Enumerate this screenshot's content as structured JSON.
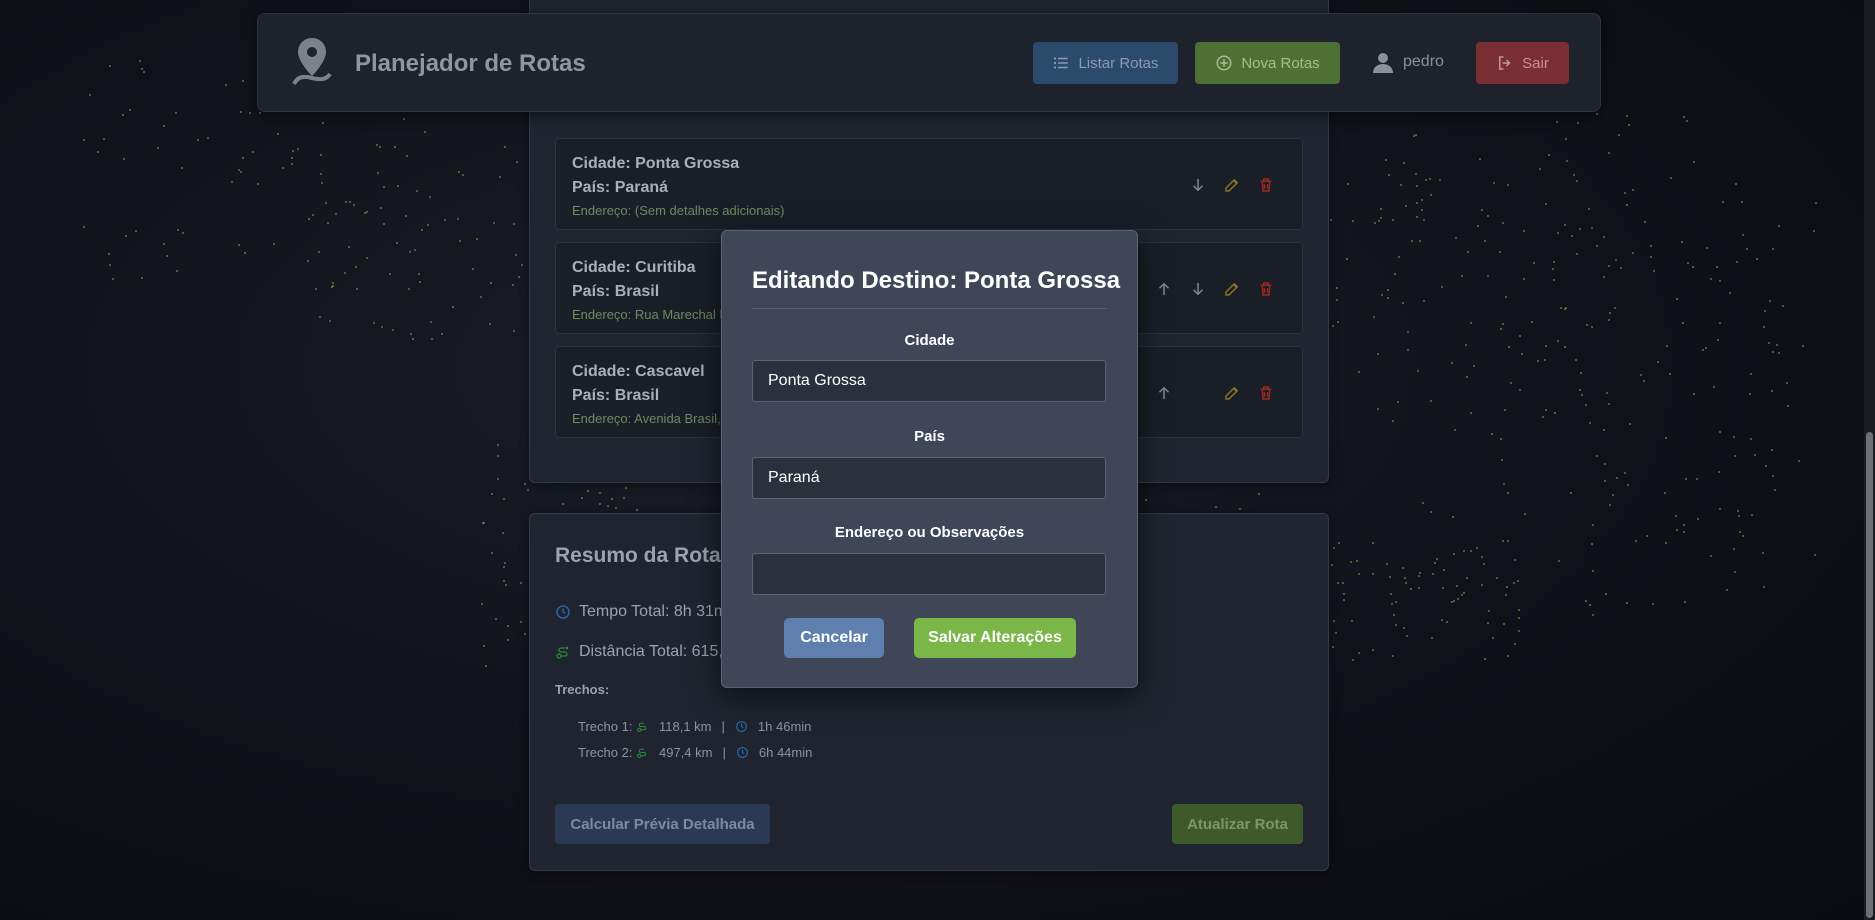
{
  "header": {
    "title": "Planejador de Rotas",
    "list_label": "Listar Rotas",
    "new_label": "Nova Rotas",
    "username": "pedro",
    "exit_label": "Sair"
  },
  "destinations": [
    {
      "city": "Cidade: Ponta Grossa",
      "country": "País: Paraná",
      "address": "Endereço: (Sem detalhes adicionais)"
    },
    {
      "city": "Cidade: Curitiba",
      "country": "País: Brasil",
      "address": "Endereço: Rua Marechal F"
    },
    {
      "city": "Cidade: Cascavel",
      "country": "País: Brasil",
      "address": "Endereço: Avenida Brasil,"
    }
  ],
  "summary": {
    "title": "Resumo da Rota",
    "total_time": "Tempo Total: 8h 31m",
    "total_distance": "Distância Total: 615,5",
    "segments_label": "Trechos:",
    "segments": [
      {
        "name": "Trecho 1:",
        "distance": "118,1 km",
        "sep": "|",
        "time": "1h 46min"
      },
      {
        "name": "Trecho 2:",
        "distance": "497,4 km",
        "sep": "|",
        "time": "6h 44min"
      }
    ],
    "preview_label": "Calcular Prévia Detalhada",
    "update_label": "Atualizar Rota"
  },
  "modal": {
    "title": "Editando Destino: Ponta Grossa",
    "city_label": "Cidade",
    "city_value": "Ponta Grossa",
    "country_label": "País",
    "country_value": "Paraná",
    "address_label": "Endereço ou Observações",
    "address_value": "",
    "cancel_label": "Cancelar",
    "save_label": "Salvar Alterações"
  },
  "colors": {
    "accent_green": "#7ab648",
    "accent_blue": "#5f7fae",
    "danger_red": "#c0392b",
    "edit_yellow": "#c9a227"
  }
}
